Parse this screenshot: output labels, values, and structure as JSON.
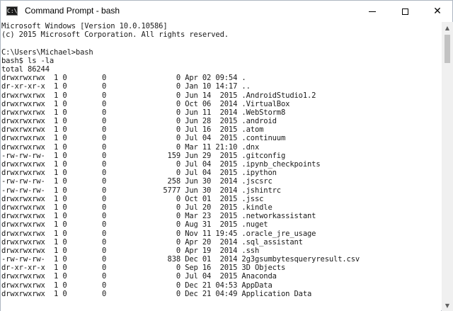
{
  "window": {
    "title": "Command Prompt - bash",
    "icon_text": "C:\\",
    "controls": {
      "minimize": "",
      "maximize": "",
      "close": "✕"
    }
  },
  "console": {
    "lines": [
      "Microsoft Windows [Version 10.0.10586]",
      "(c) 2015 Microsoft Corporation. All rights reserved.",
      "",
      "C:\\Users\\Michael>bash",
      "bash$ ls -la",
      "total 86244",
      "drwxrwxrwx  1 0        0                0 Apr 02 09:54 .",
      "dr-xr-xr-x  1 0        0                0 Jan 10 14:17 ..",
      "drwxrwxrwx  1 0        0                0 Jun 14  2015 .AndroidStudio1.2",
      "drwxrwxrwx  1 0        0                0 Oct 06  2014 .VirtualBox",
      "drwxrwxrwx  1 0        0                0 Jun 11  2014 .WebStorm8",
      "drwxrwxrwx  1 0        0                0 Jun 28  2015 .android",
      "drwxrwxrwx  1 0        0                0 Jul 16  2015 .atom",
      "drwxrwxrwx  1 0        0                0 Jul 04  2015 .continuum",
      "drwxrwxrwx  1 0        0                0 Mar 11 21:10 .dnx",
      "-rw-rw-rw-  1 0        0              159 Jun 29  2015 .gitconfig",
      "drwxrwxrwx  1 0        0                0 Jul 04  2015 .ipynb_checkpoints",
      "drwxrwxrwx  1 0        0                0 Jul 04  2015 .ipython",
      "-rw-rw-rw-  1 0        0              258 Jun 30  2014 .jscsrc",
      "-rw-rw-rw-  1 0        0             5777 Jun 30  2014 .jshintrc",
      "drwxrwxrwx  1 0        0                0 Oct 01  2015 .jssc",
      "drwxrwxrwx  1 0        0                0 Jul 20  2015 .kindle",
      "drwxrwxrwx  1 0        0                0 Mar 23  2015 .networkassistant",
      "drwxrwxrwx  1 0        0                0 Aug 31  2015 .nuget",
      "drwxrwxrwx  1 0        0                0 Nov 11 19:45 .oracle_jre_usage",
      "drwxrwxrwx  1 0        0                0 Apr 20  2014 .sql_assistant",
      "drwxrwxrwx  1 0        0                0 Apr 19  2014 .ssh",
      "-rw-rw-rw-  1 0        0              838 Dec 01  2014 2g3gsumbytesqueryresult.csv",
      "dr-xr-xr-x  1 0        0                0 Sep 16  2015 3D Objects",
      "drwxrwxrwx  1 0        0                0 Jul 04  2015 Anaconda",
      "drwxrwxrwx  1 0        0                0 Dec 21 04:53 AppData",
      "drwxrwxrwx  1 0        0                0 Dec 21 04:49 Application Data"
    ]
  },
  "scrollbar": {
    "up_arrow": "▲",
    "down_arrow": "▼"
  }
}
